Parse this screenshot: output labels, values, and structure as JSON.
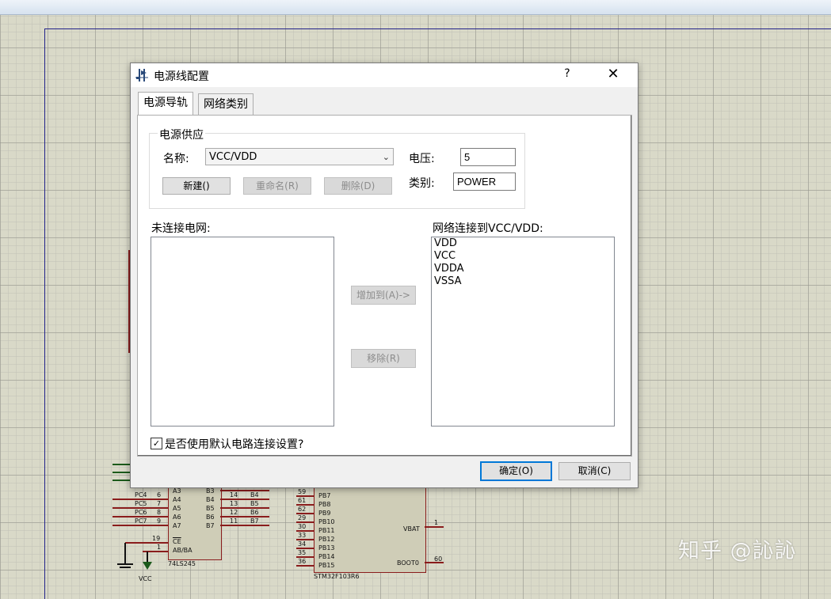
{
  "dialog": {
    "title": "电源线配置",
    "help_label": "?",
    "close_label": "✕",
    "tabs": [
      "电源导轨",
      "网络类别"
    ],
    "group_title": "电源供应",
    "name_label": "名称:",
    "name_value": "VCC/VDD",
    "voltage_label": "电压:",
    "voltage_value": "5",
    "class_label": "类别:",
    "class_value": "POWER",
    "new_button": "新建()",
    "rename_button": "重命名(R)",
    "delete_button": "删除(D)",
    "unconnected_label": "未连接电网:",
    "unconnected_nets": [],
    "connected_label": "网络连接到VCC/VDD:",
    "connected_nets": [
      "VDD",
      "VCC",
      "VDDA",
      "VSSA"
    ],
    "add_button": "增加到(A)->",
    "remove_button": "移除(R)",
    "default_checkbox_label": "是否使用默认电路连接设置?",
    "default_checked": true,
    "ok_button": "确定(O)",
    "cancel_button": "取消(C)"
  },
  "schematic": {
    "left_chip": {
      "name": "74LS245",
      "nets": [
        "PC4",
        "PC5",
        "PC6",
        "PC7"
      ],
      "pin_numbers_left": [
        "6",
        "7",
        "8",
        "9"
      ],
      "pins_left": [
        "A3",
        "A4",
        "A5",
        "A6",
        "A7"
      ],
      "pins_right": [
        "B3",
        "B4",
        "B5",
        "B6",
        "B7"
      ],
      "pin_numbers_right": [
        "14",
        "13",
        "12",
        "11"
      ],
      "right_nets": [
        "B4",
        "B5",
        "B6",
        "B7"
      ],
      "ce_label": "CE",
      "ab_label": "AB/BA",
      "ce_pin": "19",
      "ab_pin": "1",
      "vcc_label": "VCC"
    },
    "mcu": {
      "name": "STM32F103R6",
      "pins": [
        "PB7",
        "PB8",
        "PB9",
        "PB10",
        "PB11",
        "PB12",
        "PB13",
        "PB14",
        "PB15"
      ],
      "pin_numbers": [
        "59",
        "61",
        "62",
        "29",
        "30",
        "33",
        "34",
        "35",
        "36"
      ],
      "vbat_label": "VBAT",
      "vbat_pin": "1",
      "boot_label": "BOOT0",
      "boot_pin": "60"
    }
  },
  "watermark": "知乎 @訫訫"
}
